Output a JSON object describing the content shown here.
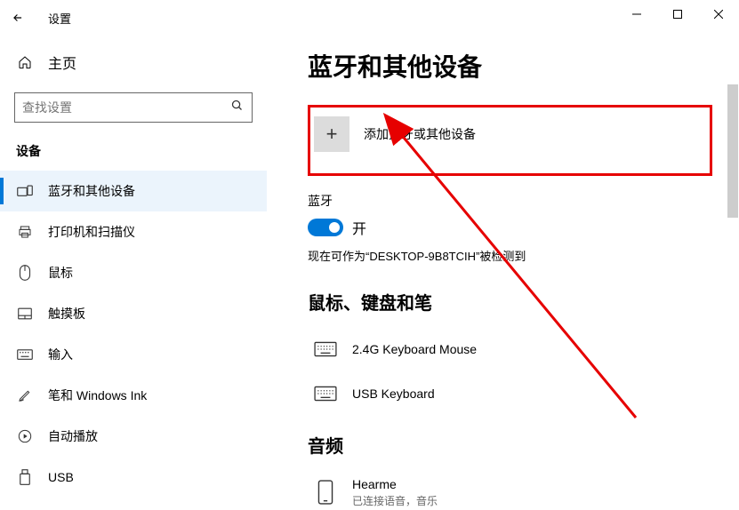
{
  "titlebar": {
    "title": "设置"
  },
  "sidebar": {
    "home": "主页",
    "search_placeholder": "查找设置",
    "section": "设备",
    "items": [
      {
        "label": "蓝牙和其他设备"
      },
      {
        "label": "打印机和扫描仪"
      },
      {
        "label": "鼠标"
      },
      {
        "label": "触摸板"
      },
      {
        "label": "输入"
      },
      {
        "label": "笔和 Windows Ink"
      },
      {
        "label": "自动播放"
      },
      {
        "label": "USB"
      }
    ]
  },
  "main": {
    "title": "蓝牙和其他设备",
    "add_label": "添加蓝牙或其他设备",
    "bt_heading": "蓝牙",
    "bt_toggle_text": "开",
    "bt_status": "现在可作为“DESKTOP-9B8TCIH”被检测到",
    "section_mouse": "鼠标、键盘和笔",
    "devices_kb": [
      {
        "name": "2.4G Keyboard Mouse"
      },
      {
        "name": "USB Keyboard"
      }
    ],
    "section_audio": "音频",
    "devices_audio": [
      {
        "name": "Hearme",
        "status": "已连接语音，音乐"
      }
    ]
  }
}
